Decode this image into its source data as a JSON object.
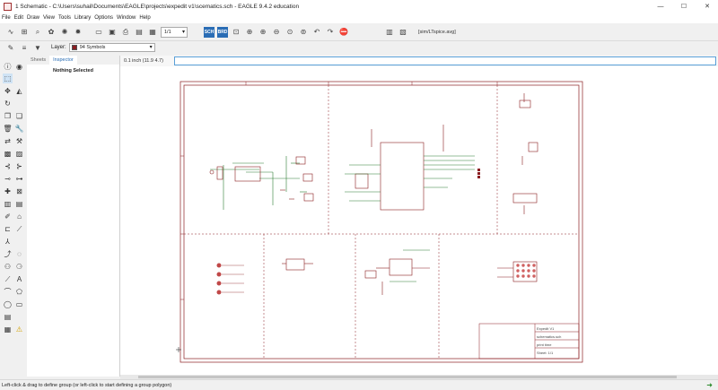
{
  "window": {
    "title": "1 Schematic - C:\\Users\\suhail\\Documents\\EAGLE\\projects\\expedit v1\\scematics.sch - EAGLE 9.4.2 education",
    "minimize": "—",
    "maximize": "☐",
    "close": "✕"
  },
  "menu": [
    "File",
    "Edit",
    "Draw",
    "View",
    "Tools",
    "Library",
    "Options",
    "Window",
    "Help"
  ],
  "toolbar": {
    "sheet_select": "1/1",
    "command_hint": "[sim/LTspice.avg]"
  },
  "toolbar2": {
    "layer_label": "Layer:",
    "layer_value": "94 Symbols",
    "layer_color": "#8b1e22"
  },
  "panel": {
    "tabs": [
      "Sheets",
      "Inspector"
    ],
    "active_tab": "Inspector",
    "message": "Nothing Selected"
  },
  "coordbar": {
    "coord": "0.1 inch (11.9 4.7)",
    "command_value": ""
  },
  "schematic": {
    "frame_color": "#8b1e22",
    "net_color": "#2e7d32",
    "title_block": [
      "Expedit V1",
      "schematics.sch",
      "print time",
      "Sheet: 1/1"
    ]
  },
  "status": {
    "message": "Left-click & drag to define group (or left-click to start defining a group polygon)"
  }
}
